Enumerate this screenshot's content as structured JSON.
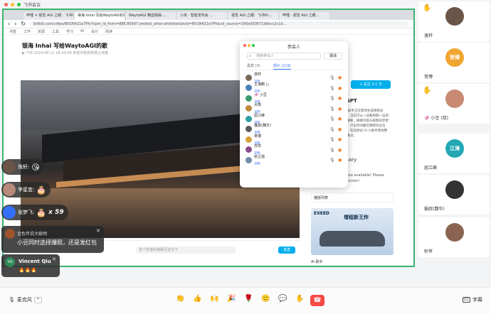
{
  "meeting": {
    "title": "飞书会议",
    "colors": {
      "share_border": "#3cb371",
      "accent": "#3370ff",
      "danger": "#f54a45"
    }
  },
  "browser": {
    "tabs": [
      {
        "label": "哔哩 ✕ 视觉 AGI 之眼：飞书Hi..."
      },
      {
        "label": "得海 Inhai 写给WaytoAGI的歌"
      },
      {
        "label": "WaytoAGI 精选歌曲 ..."
      },
      {
        "label": "小米 · 智能发布会 ..."
      },
      {
        "label": "视觉 AGI 之眼：飞书Hi..."
      },
      {
        "label": "哔哩 · 视觉 AGI 之眼..."
      }
    ],
    "url": "bilibili.com/video/BV1N421e7Ph/?spm_id_from=888.80997.embed_other.whitelist&bvid=BV1N421e7Ph&vd_source=290a093671b6ecc2c1b...",
    "bookmarks": [
      "书签",
      "工作",
      "资源",
      "工具",
      "学习",
      "AI",
      "设计",
      "阅读"
    ]
  },
  "video_page": {
    "title": "银海 Inhai 写给WaytoAGI的歌",
    "meta": "▶ 778   2024-06-12 18:43:09   未经作者授权禁止转载",
    "danmu_placeholder": "发个友善的弹幕见证当下",
    "send_label": "发送",
    "follow_label": "+ 关注 3.1 万",
    "summary_title": "hatGPT",
    "summary_text": "AI 助手正在帮你生成视频总结，当前可以一边看视频一边浏览摘要，摘要内容与视频同步更新，点击时间戳可跳转对应位置，欢迎尝试 AI 小助手帮你整理重点。",
    "summary_heading": "mary",
    "not_available": "...ata available! Please ...ection!",
    "playlist_label": "播放列表",
    "ad_brand": "EXEED",
    "ad_headline": "增程新王炸",
    "ai_tool_label": "AI 助手"
  },
  "participants": {
    "title": "参会人",
    "search_placeholder": "搜索参会人",
    "invite_label": "邀请",
    "tabs": [
      {
        "label": "嘉宾 (3)"
      },
      {
        "label": "观众 (119)"
      }
    ],
    "list": [
      {
        "name": "逸轩",
        "tag": "主持",
        "color": "#7a6a5a"
      },
      {
        "name": "王海鹏 ◻",
        "tag": "主持",
        "color": "#4a7fb5"
      },
      {
        "name": "🦑 小豆",
        "tag": "主持",
        "color": "#3b9a6a"
      },
      {
        "name": "大熊",
        "tag": "主持",
        "color": "#c08a3e"
      },
      {
        "name": "屈江峰",
        "tag": "主持",
        "color": "#2f9fa4"
      },
      {
        "name": "猫叔(魏华)",
        "tag": "主持",
        "color": "#5b5b5b"
      },
      {
        "name": "常博",
        "tag": "主持",
        "color": "#d8a13a"
      },
      {
        "name": "苏夸",
        "tag": "主持",
        "color": "#8a4c8f"
      },
      {
        "name": "张立强",
        "tag": "主持",
        "color": "#6f8aa8"
      }
    ]
  },
  "sidebar": {
    "tiles": [
      {
        "name": "逸轩",
        "hand": true,
        "avatar_color": "#6b5548",
        "initials": ""
      },
      {
        "name": "常博",
        "hand": false,
        "avatar_color": "#f0a531",
        "initials": "常博"
      },
      {
        "name": "🦑 小豆 (我)",
        "hand": true,
        "avatar_color": "#c98a74",
        "initials": ""
      },
      {
        "name": "屈江峰",
        "hand": false,
        "avatar_color": "#23a8b4",
        "initials": "江涛"
      },
      {
        "name": "猫叔(魏华)",
        "hand": false,
        "avatar_color": "#333333",
        "initials": ""
      },
      {
        "name": "秒爷",
        "hand": false,
        "avatar_color": "#8a6450",
        "initials": ""
      }
    ]
  },
  "reactions": [
    {
      "name": "逸轩:",
      "emoji": "😘",
      "count": "",
      "avatar_color": "#6b5548"
    },
    {
      "name": "李星宜:",
      "emoji": "🎂",
      "count": "",
      "avatar_color": "#b88a7a"
    },
    {
      "name": "张梦飞:",
      "emoji": "🎂",
      "count": "x 59",
      "avatar_color": "#3370ff"
    }
  ],
  "messages": [
    {
      "sender": "金色传说大聪明",
      "text": "小豆同时选择爆照，还是发红包",
      "avatar_color": "#a0522d"
    },
    {
      "sender": "Vincent Qiu",
      "text": "🔥🔥🔥",
      "avatar_color": "#2e8b57",
      "initials": "VQ"
    }
  ],
  "bottombar": {
    "mic_label": "麦克风",
    "icons": [
      {
        "name": "clap-icon",
        "glyph": "👏"
      },
      {
        "name": "thumbs-up-icon",
        "glyph": "👍"
      },
      {
        "name": "cheer-icon",
        "glyph": "🙌"
      },
      {
        "name": "party-icon",
        "glyph": "🎉"
      },
      {
        "name": "rose-icon",
        "glyph": "🌹"
      },
      {
        "name": "smile-icon",
        "glyph": "🙂"
      },
      {
        "name": "chat-icon",
        "glyph": "💬"
      },
      {
        "name": "raise-hand-icon",
        "glyph": "✋"
      }
    ],
    "leave_glyph": "☎",
    "captions_label": "字幕"
  }
}
